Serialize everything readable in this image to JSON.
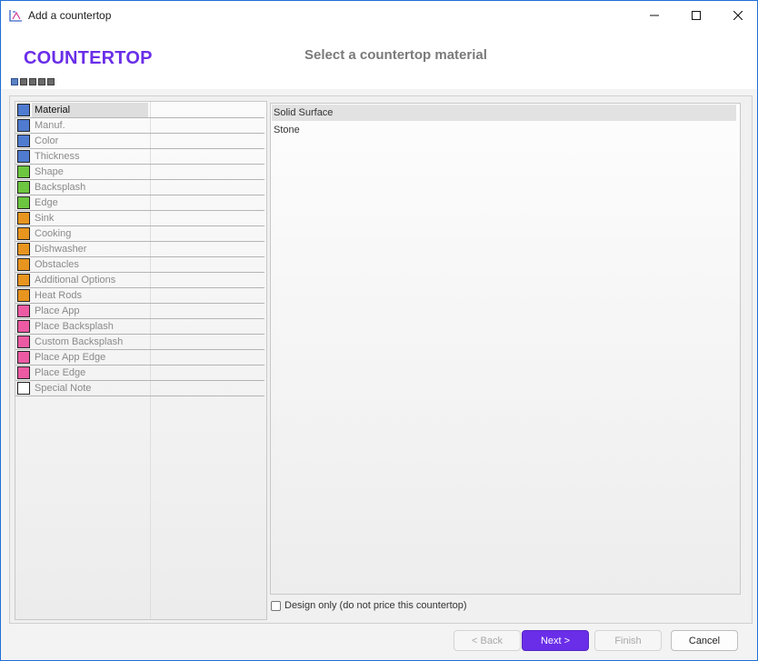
{
  "window": {
    "title": "Add a countertop",
    "icon": "countertop-app-icon"
  },
  "header": {
    "brand": "COUNTERTOP",
    "subtitle": "Select a countertop material",
    "step_count": 5,
    "current_step": 1
  },
  "nav": {
    "items": [
      {
        "label": "Material",
        "color": "#4f7bd0",
        "selected": true
      },
      {
        "label": "Manuf.",
        "color": "#4f7bd0"
      },
      {
        "label": "Color",
        "color": "#4f7bd0"
      },
      {
        "label": "Thickness",
        "color": "#4f7bd0"
      },
      {
        "label": "Shape",
        "color": "#6dc63f"
      },
      {
        "label": "Backsplash",
        "color": "#6dc63f"
      },
      {
        "label": "Edge",
        "color": "#6dc63f"
      },
      {
        "label": "Sink",
        "color": "#e8951f"
      },
      {
        "label": "Cooking",
        "color": "#e8951f"
      },
      {
        "label": "Dishwasher",
        "color": "#e8951f"
      },
      {
        "label": "Obstacles",
        "color": "#e8951f"
      },
      {
        "label": "Additional Options",
        "color": "#e8951f"
      },
      {
        "label": "Heat Rods",
        "color": "#e8951f"
      },
      {
        "label": "Place App",
        "color": "#ec5aa3"
      },
      {
        "label": "Place Backsplash",
        "color": "#ec5aa3"
      },
      {
        "label": "Custom Backsplash",
        "color": "#ec5aa3"
      },
      {
        "label": "Place App Edge",
        "color": "#ec5aa3"
      },
      {
        "label": "Place Edge",
        "color": "#ec5aa3"
      },
      {
        "label": "Special Note",
        "color": "#ffffff"
      }
    ]
  },
  "materials": {
    "options": [
      {
        "label": "Solid Surface",
        "selected": true
      },
      {
        "label": "Stone"
      }
    ]
  },
  "design_only": {
    "label": "Design only (do not price this countertop)",
    "checked": false
  },
  "buttons": {
    "back": "< Back",
    "next": "Next >",
    "finish": "Finish",
    "cancel": "Cancel"
  }
}
